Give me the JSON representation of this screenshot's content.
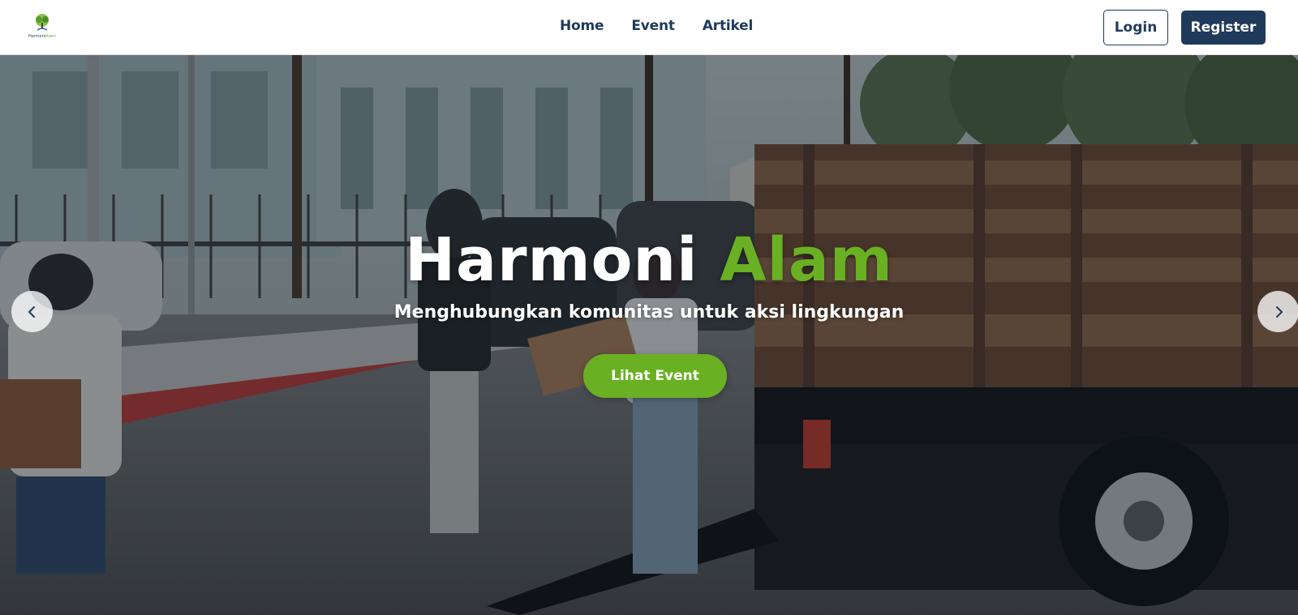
{
  "header": {
    "logo": {
      "text_part1": "Harmoni",
      "text_part2": "Alam",
      "icon": "tree-icon"
    },
    "nav": [
      {
        "label": "Home"
      },
      {
        "label": "Event"
      },
      {
        "label": "Artikel"
      }
    ],
    "login_label": "Login",
    "register_label": "Register"
  },
  "hero": {
    "title_part1": "Harmoni",
    "title_part2": "Alam",
    "subtitle": "Menghubungkan komunitas untuk aksi lingkungan",
    "cta_label": "Lihat Event",
    "prev_icon": "chevron-left-icon",
    "next_icon": "chevron-right-icon"
  },
  "colors": {
    "primary": "#1f3a5a",
    "accent": "#6ab023",
    "background": "#ffffff"
  }
}
